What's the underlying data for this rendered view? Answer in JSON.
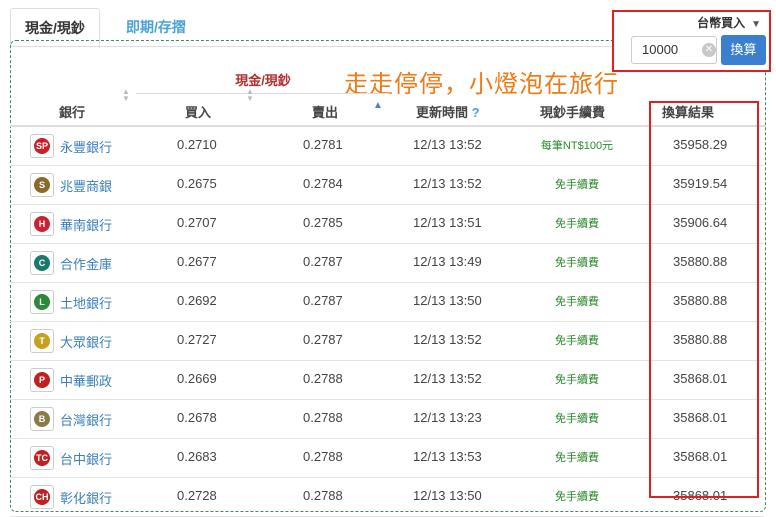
{
  "tabs": {
    "active": "現金/現鈔",
    "inactive": "即期/存摺"
  },
  "converter": {
    "currency_select": "台幣買入",
    "amount": "10000",
    "calc_button": "換算"
  },
  "overlay_text": "走走停停，小燈泡在旅行",
  "table": {
    "group_header": "現金/現鈔",
    "headers": {
      "bank": "銀行",
      "buy": "買入",
      "sell": "賣出",
      "time": "更新時間",
      "fee": "現鈔手續費",
      "result": "換算結果"
    },
    "rows": [
      {
        "bank": "永豐銀行",
        "buy": "0.2710",
        "sell": "0.2781",
        "time": "12/13 13:52",
        "fee": "每筆NT$100元",
        "result": "35958.29",
        "logo_color": "#c8202a",
        "logo_glyph": "SP"
      },
      {
        "bank": "兆豐商銀",
        "buy": "0.2675",
        "sell": "0.2784",
        "time": "12/13 13:52",
        "fee": "免手續費",
        "result": "35919.54",
        "logo_color": "#8a6a2a",
        "logo_glyph": "S"
      },
      {
        "bank": "華南銀行",
        "buy": "0.2707",
        "sell": "0.2785",
        "time": "12/13 13:51",
        "fee": "免手續費",
        "result": "35906.64",
        "logo_color": "#d02030",
        "logo_glyph": "H"
      },
      {
        "bank": "合作金庫",
        "buy": "0.2677",
        "sell": "0.2787",
        "time": "12/13 13:49",
        "fee": "免手續費",
        "result": "35880.88",
        "logo_color": "#1a7a6a",
        "logo_glyph": "C"
      },
      {
        "bank": "土地銀行",
        "buy": "0.2692",
        "sell": "0.2787",
        "time": "12/13 13:50",
        "fee": "免手續費",
        "result": "35880.88",
        "logo_color": "#2a8a3a",
        "logo_glyph": "L"
      },
      {
        "bank": "大眾銀行",
        "buy": "0.2727",
        "sell": "0.2787",
        "time": "12/13 13:52",
        "fee": "免手續費",
        "result": "35880.88",
        "logo_color": "#c8a020",
        "logo_glyph": "T"
      },
      {
        "bank": "中華郵政",
        "buy": "0.2669",
        "sell": "0.2788",
        "time": "12/13 13:52",
        "fee": "免手續費",
        "result": "35868.01",
        "logo_color": "#c02020",
        "logo_glyph": "P"
      },
      {
        "bank": "台灣銀行",
        "buy": "0.2678",
        "sell": "0.2788",
        "time": "12/13 13:23",
        "fee": "免手續費",
        "result": "35868.01",
        "logo_color": "#8a7a4a",
        "logo_glyph": "B"
      },
      {
        "bank": "台中銀行",
        "buy": "0.2683",
        "sell": "0.2788",
        "time": "12/13 13:53",
        "fee": "免手續費",
        "result": "35868.01",
        "logo_color": "#c02020",
        "logo_glyph": "TC"
      },
      {
        "bank": "彰化銀行",
        "buy": "0.2728",
        "sell": "0.2788",
        "time": "12/13 13:50",
        "fee": "免手續費",
        "result": "35868.01",
        "logo_color": "#c02020",
        "logo_glyph": "CH"
      }
    ]
  },
  "colors": {
    "accent_blue": "#3a7fd0",
    "highlight_red": "#e02020",
    "fee_green": "#2a8a2a",
    "overlay_orange": "#f07a14"
  }
}
